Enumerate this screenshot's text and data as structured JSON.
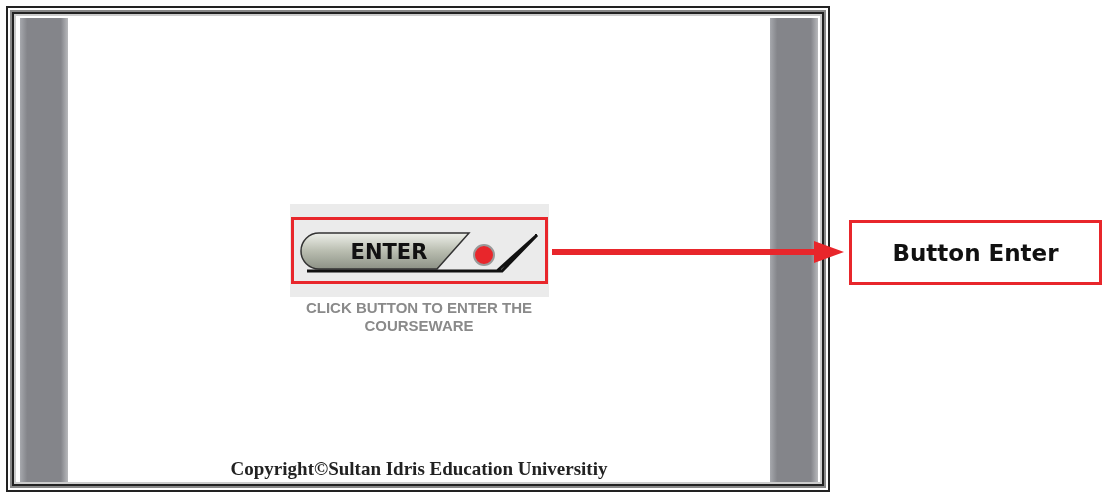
{
  "enter_button": {
    "label": "ENTER"
  },
  "instruction": "CLICK BUTTON TO ENTER THE COURSEWARE",
  "copyright": "Copyright©Sultan Idris Education Universitiy",
  "callout": {
    "label": "Button Enter"
  }
}
